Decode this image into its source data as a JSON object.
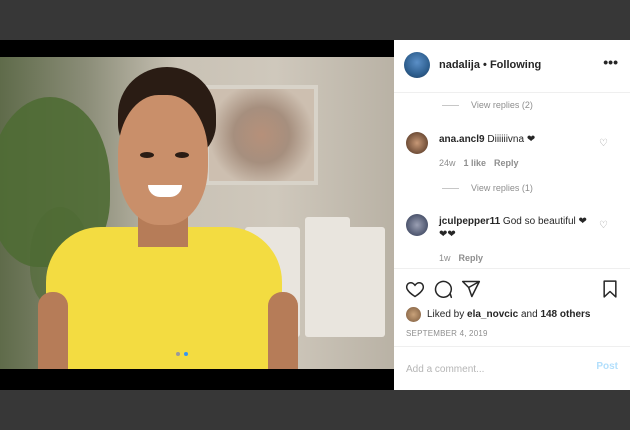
{
  "post": {
    "carousel": {
      "total": 2,
      "active_index": 1
    }
  },
  "header": {
    "username": "nadalija",
    "separator": "•",
    "follow_status": "Following",
    "more_icon": "more-horizontal-icon"
  },
  "comments": [
    {
      "type": "view_replies",
      "label": "View replies (2)"
    },
    {
      "type": "comment",
      "username": "ana.ancl9",
      "text": "Diiiiiivna ❤",
      "age": "24w",
      "likes": "1 like",
      "reply_label": "Reply"
    },
    {
      "type": "view_replies",
      "label": "View replies (1)"
    },
    {
      "type": "comment",
      "username": "jculpepper11",
      "text": "God so beautiful ❤ ❤❤",
      "age": "1w",
      "reply_label": "Reply"
    }
  ],
  "actions": {
    "like_icon": "heart-icon",
    "comment_icon": "comment-icon",
    "share_icon": "share-icon",
    "save_icon": "bookmark-icon"
  },
  "likes": {
    "prefix": "Liked by",
    "user": "ela_novcic",
    "conjunction": "and",
    "others": "148 others"
  },
  "date": "SEPTEMBER 4, 2019",
  "comment_box": {
    "placeholder": "Add a comment...",
    "post_label": "Post"
  },
  "colors": {
    "background": "#373737",
    "link_disabled": "#b2dffc",
    "accent": "#3897f0",
    "dress": "#f3dc41"
  }
}
